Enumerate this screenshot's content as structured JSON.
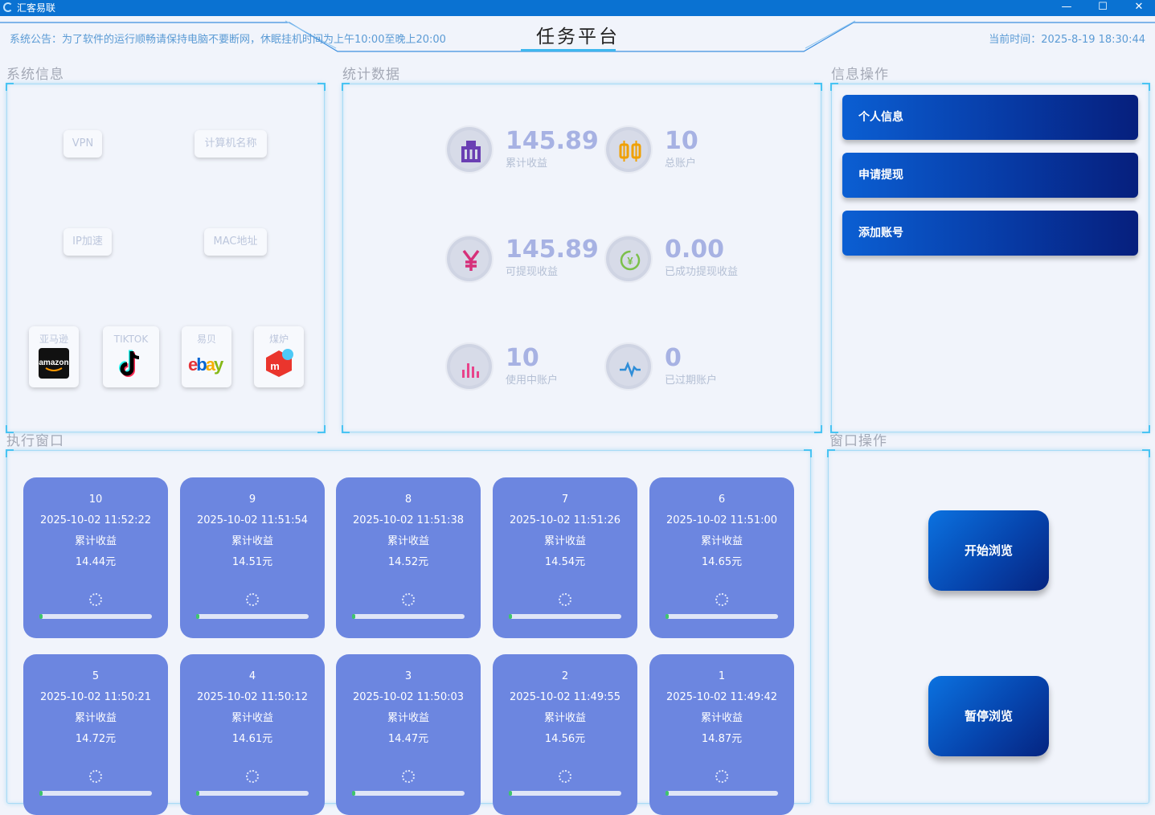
{
  "window": {
    "app_title": "汇客易联",
    "minimize": "—",
    "maximize": "☐",
    "close": "✕"
  },
  "header": {
    "notice": "系统公告：为了软件的运行顺畅请保持电脑不要断网，休眠挂机时间为上午10:00至晚上20:00",
    "title": "任务平台",
    "clock_label": "当前时间：",
    "clock_value": "2025-8-19 18:30:44"
  },
  "sections": {
    "system_info": "系统信息",
    "statistics": "统计数据",
    "info_ops": "信息操作",
    "exec_window": "执行窗口",
    "window_ops": "窗口操作"
  },
  "system_info": {
    "vpn": "VPN",
    "computer_name": "计算机名称",
    "ip_speed": "IP加速",
    "mac": "MAC地址",
    "platforms": [
      {
        "label": "亚马逊",
        "icon": "amazon-icon"
      },
      {
        "label": "TIKTOK",
        "icon": "tiktok-icon"
      },
      {
        "label": "易贝",
        "icon": "ebay-icon"
      },
      {
        "label": "煤炉",
        "icon": "mercari-icon"
      }
    ]
  },
  "statistics": {
    "total_income": {
      "value": "145.89",
      "label": "累计收益",
      "icon": "building-icon",
      "color": "#6a3fb3"
    },
    "total_accounts": {
      "value": "10",
      "label": "总账户",
      "icon": "lantern-icon",
      "color": "#f0a000"
    },
    "withdrawable": {
      "value": "145.89",
      "label": "可提现收益",
      "icon": "yen-icon",
      "color": "#d6307a"
    },
    "withdrawn": {
      "value": "0.00",
      "label": "已成功提现收益",
      "icon": "refresh-coin-icon",
      "color": "#7cc04a"
    },
    "active_accounts": {
      "value": "10",
      "label": "使用中账户",
      "icon": "bar-chart-icon",
      "color": "#e8448b"
    },
    "expired_accounts": {
      "value": "0",
      "label": "已过期账户",
      "icon": "pulse-icon",
      "color": "#2f8ed8"
    }
  },
  "info_ops": {
    "personal_info": "个人信息",
    "withdraw": "申请提现",
    "add_account": "添加账号"
  },
  "window_ops": {
    "start": "开始浏览",
    "pause": "暂停浏览"
  },
  "cards": [
    {
      "id": "10",
      "time": "2025-10-02 11:52:22",
      "label": "累计收益",
      "amount": "14.44元"
    },
    {
      "id": "9",
      "time": "2025-10-02 11:51:54",
      "label": "累计收益",
      "amount": "14.51元"
    },
    {
      "id": "8",
      "time": "2025-10-02 11:51:38",
      "label": "累计收益",
      "amount": "14.52元"
    },
    {
      "id": "7",
      "time": "2025-10-02 11:51:26",
      "label": "累计收益",
      "amount": "14.54元"
    },
    {
      "id": "6",
      "time": "2025-10-02 11:51:00",
      "label": "累计收益",
      "amount": "14.65元"
    },
    {
      "id": "5",
      "time": "2025-10-02 11:50:21",
      "label": "累计收益",
      "amount": "14.72元"
    },
    {
      "id": "4",
      "time": "2025-10-02 11:50:12",
      "label": "累计收益",
      "amount": "14.61元"
    },
    {
      "id": "3",
      "time": "2025-10-02 11:50:03",
      "label": "累计收益",
      "amount": "14.47元"
    },
    {
      "id": "2",
      "time": "2025-10-02 11:49:55",
      "label": "累计收益",
      "amount": "14.56元"
    },
    {
      "id": "1",
      "time": "2025-10-02 11:49:42",
      "label": "累计收益",
      "amount": "14.87元"
    }
  ],
  "card_progress": 0.03
}
